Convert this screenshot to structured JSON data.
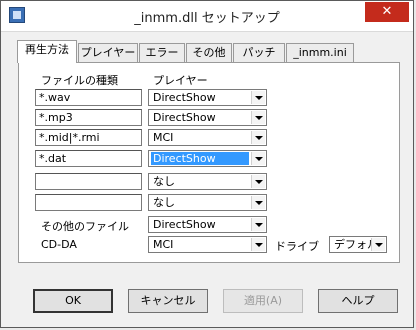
{
  "window": {
    "title": "_inmm.dll セットアップ",
    "close_glyph": "✕"
  },
  "tabs": [
    {
      "label": "再生方法",
      "active": true
    },
    {
      "label": "プレイヤー",
      "active": false
    },
    {
      "label": "エラー",
      "active": false
    },
    {
      "label": "その他",
      "active": false
    },
    {
      "label": "パッチ",
      "active": false
    },
    {
      "label": "_inmm.ini",
      "active": false
    }
  ],
  "headers": {
    "file_type": "ファイルの種類",
    "player": "プレイヤー"
  },
  "rows": [
    {
      "ext": "*.wav",
      "player": "DirectShow"
    },
    {
      "ext": "*.mp3",
      "player": "DirectShow"
    },
    {
      "ext": "*.mid|*.rmi",
      "player": "MCI"
    },
    {
      "ext": "*.dat",
      "player": "DirectShow",
      "highlighted": true
    },
    {
      "ext": "",
      "player": "なし"
    },
    {
      "ext": "",
      "player": "なし"
    }
  ],
  "other_files": {
    "label": "その他のファイル",
    "player": "DirectShow"
  },
  "cdda": {
    "label": "CD-DA",
    "player": "MCI",
    "drive_label": "ドライブ",
    "drive_value": "デフォルト"
  },
  "buttons": {
    "ok": "OK",
    "cancel": "キャンセル",
    "apply": "適用(A)",
    "help": "ヘルプ"
  }
}
